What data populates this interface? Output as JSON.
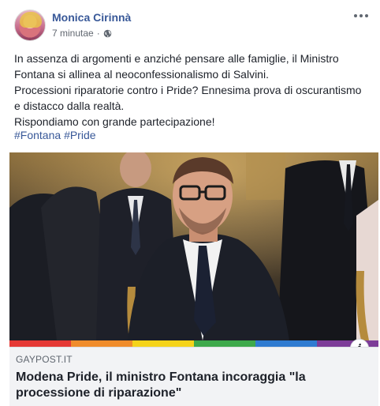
{
  "post": {
    "author": "Monica Cirinnà",
    "time": "7 minutae",
    "separator": "·",
    "body_lines": [
      "In assenza di argomenti e anziché pensare alle famiglie, il Ministro",
      "Fontana si allinea al neoconfessionalismo di Salvini.",
      "Processioni riparatorie contro i Pride? Ennesima prova di oscurantismo",
      "e distacco dalla realtà.",
      "Rispondiamo con grande partecipazione!"
    ],
    "hashtags": [
      "#Fontana",
      "#Pride"
    ]
  },
  "link": {
    "domain": "GAYPOST.IT",
    "headline": "Modena Pride, il ministro Fontana incoraggia \"la processione di riparazione\"",
    "info_symbol": "i",
    "rainbow_colors": [
      "#e53935",
      "#f08c2b",
      "#f5d31a",
      "#3ea94b",
      "#2f7bd1",
      "#7d3c98"
    ]
  },
  "icons": {
    "globe": "globe-icon",
    "more": "more-options-icon",
    "info": "info-icon"
  },
  "colors": {
    "link_blue": "#385898",
    "text": "#1d2129",
    "meta": "#616770",
    "caption_bg": "#f2f3f5"
  }
}
